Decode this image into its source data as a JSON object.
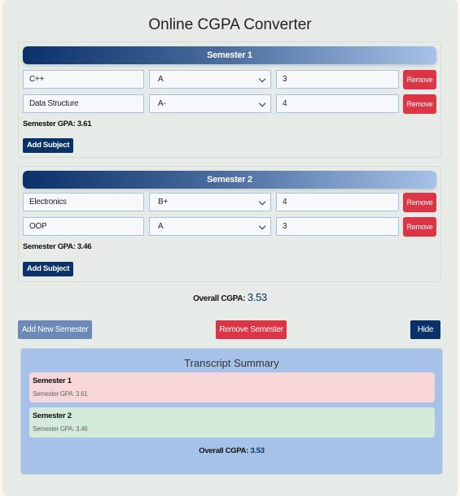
{
  "title": "Online CGPA Converter",
  "semesters": [
    {
      "header": "Semester 1",
      "subjects": [
        {
          "name": "C++",
          "grade": "A",
          "credits": "3",
          "remove_label": "Remove"
        },
        {
          "name": "Data Structure",
          "grade": "A-",
          "credits": "4",
          "remove_label": "Remove"
        }
      ],
      "gpa_text": "Semester GPA: 3.61",
      "add_subject_label": "Add Subject"
    },
    {
      "header": "Semester 2",
      "subjects": [
        {
          "name": "Electronics",
          "grade": "B+",
          "credits": "4",
          "remove_label": "Remove"
        },
        {
          "name": "OOP",
          "grade": "A",
          "credits": "3",
          "remove_label": "Remove"
        }
      ],
      "gpa_text": "Semester GPA: 3.46",
      "add_subject_label": "Add Subject"
    }
  ],
  "overall": {
    "label": "Overall CGPA:",
    "value": "3.53"
  },
  "actions": {
    "add_semester": "Add New Semester",
    "remove_semester": "Remove Semester",
    "hide": "Hide"
  },
  "summary": {
    "title": "Transcript Summary",
    "items": [
      {
        "name": "Semester 1",
        "gpa": "Semester GPA: 3.61",
        "color": "#f8d7da"
      },
      {
        "name": "Semester 2",
        "gpa": "Semester GPA: 3.46",
        "color": "#d4ebdb"
      }
    ],
    "overall_label": "Overall CGPA:",
    "overall_value": "3.53"
  },
  "colors": {
    "primary": "#0b3169",
    "danger": "#dc3545",
    "secondary": "#6c8ab8",
    "summary_bg": "#a7c2e8"
  },
  "icons": {
    "select_chevron": "chevron-down-icon"
  }
}
